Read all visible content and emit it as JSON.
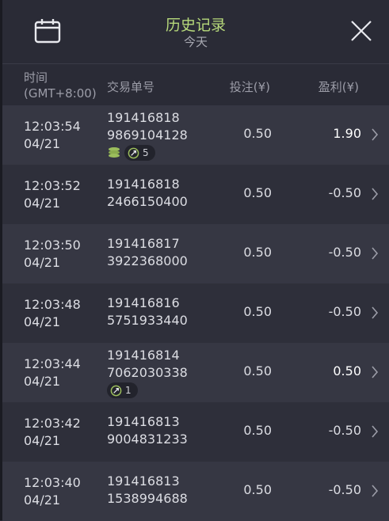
{
  "header": {
    "title": "历史记录",
    "subtitle": "今天"
  },
  "columns": {
    "time_line1": "时间",
    "time_line2": "(GMT+8:00)",
    "id": "交易单号",
    "bet": "投注(¥)",
    "profit": "盈利(¥)"
  },
  "rows": [
    {
      "time": "12:03:54",
      "date": "04/21",
      "id1": "191416818",
      "id2": "9869104128",
      "bet": "0.50",
      "profit": "1.90",
      "badge_count": "5",
      "coins": true
    },
    {
      "time": "12:03:52",
      "date": "04/21",
      "id1": "191416818",
      "id2": "2466150400",
      "bet": "0.50",
      "profit": "-0.50"
    },
    {
      "time": "12:03:50",
      "date": "04/21",
      "id1": "191416817",
      "id2": "3922368000",
      "bet": "0.50",
      "profit": "-0.50"
    },
    {
      "time": "12:03:48",
      "date": "04/21",
      "id1": "191416816",
      "id2": "5751933440",
      "bet": "0.50",
      "profit": "-0.50"
    },
    {
      "time": "12:03:44",
      "date": "04/21",
      "id1": "191416814",
      "id2": "7062030338",
      "bet": "0.50",
      "profit": "0.50",
      "badge_count": "1",
      "coins": false
    },
    {
      "time": "12:03:42",
      "date": "04/21",
      "id1": "191416813",
      "id2": "9004831233",
      "bet": "0.50",
      "profit": "-0.50"
    },
    {
      "time": "12:03:40",
      "date": "04/21",
      "id1": "191416813",
      "id2": "1538994688",
      "bet": "0.50",
      "profit": "-0.50"
    }
  ],
  "icons": {
    "calendar": "calendar-icon",
    "close": "close-icon",
    "row_chevron": "chevron-right-icon",
    "coins": "coins-icon",
    "spin": "spin-icon"
  },
  "colors": {
    "title": "#b7d97b",
    "accent_coin": "#9bbd5c"
  }
}
